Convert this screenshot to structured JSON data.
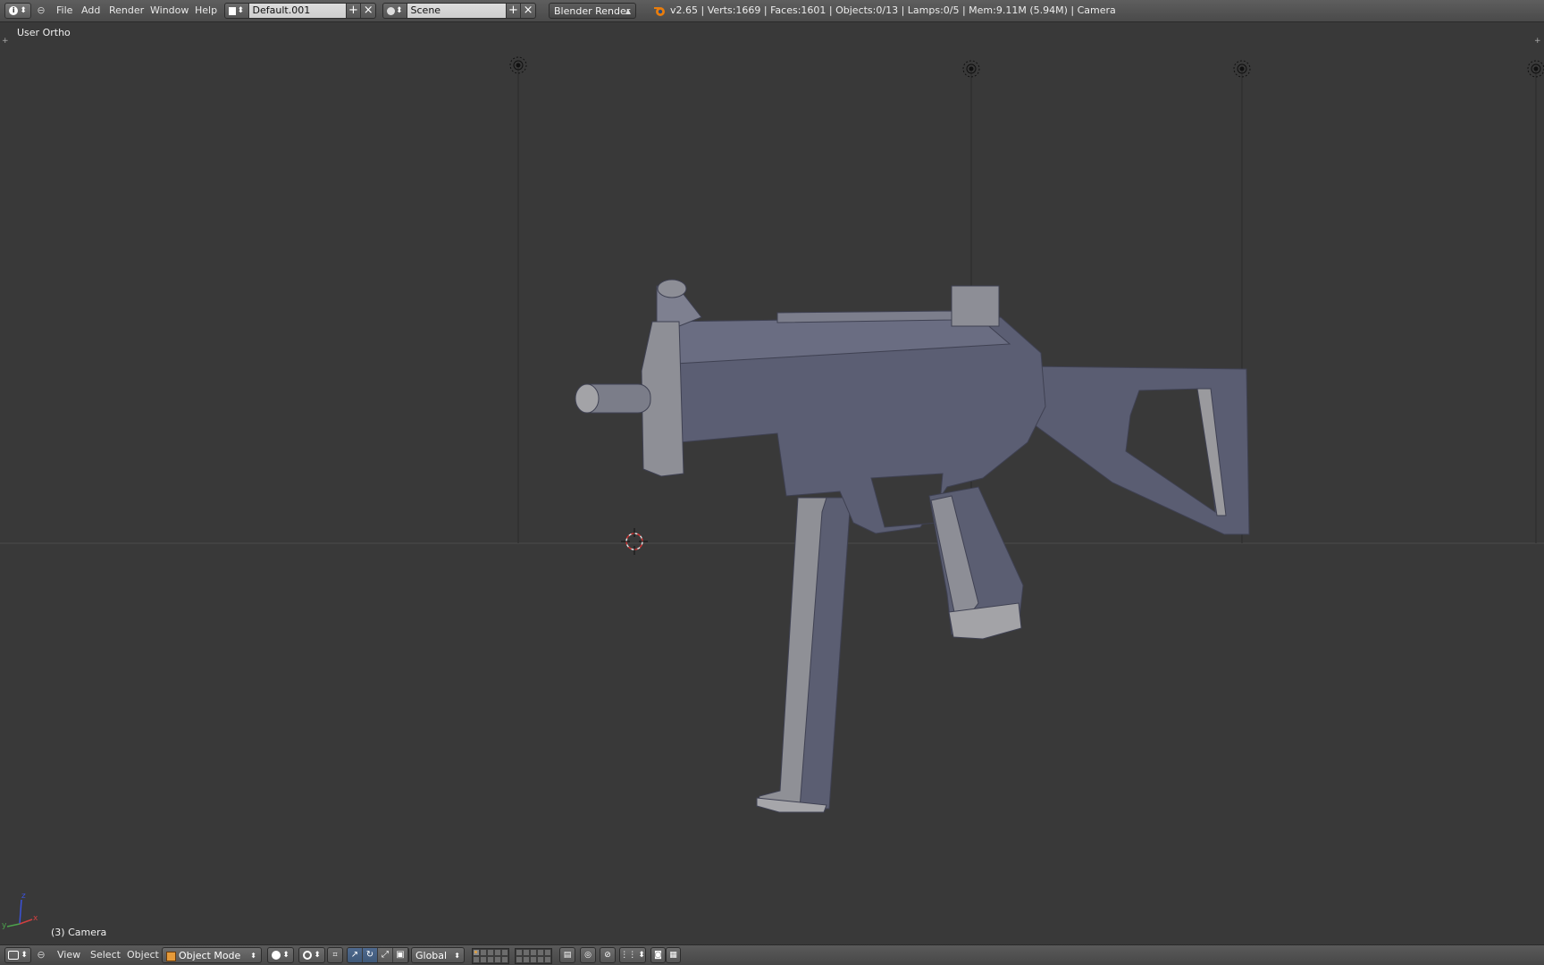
{
  "top_header": {
    "editor_type_icon": "info-icon",
    "menus": [
      "File",
      "Add",
      "Render",
      "Window",
      "Help"
    ],
    "screen_layout": {
      "icon": "screen-layout-icon",
      "value": "Default.001"
    },
    "scene": {
      "icon": "scene-icon",
      "value": "Scene"
    },
    "render_engine": "Blender Render",
    "stats": "v2.65 | Verts:1669 | Faces:1601 | Objects:0/13 | Lamps:0/5 | Mem:9.11M (5.94M) | Camera"
  },
  "viewport": {
    "view_label": "User Ortho",
    "active_object_label": "(3) Camera",
    "axes": {
      "x": "x",
      "y": "y",
      "z": "z"
    },
    "colors": {
      "background": "#393939",
      "model_body": "#5a5d72",
      "model_light": "#9a9a9e"
    }
  },
  "bottom_header": {
    "editor_type_icon": "3d-view-icon",
    "menus": [
      "View",
      "Select",
      "Object"
    ],
    "mode": "Object Mode",
    "shading_icon": "solid-shading-icon",
    "pivot_icon": "pivot-point-icon",
    "transform_orientation": "Global"
  }
}
